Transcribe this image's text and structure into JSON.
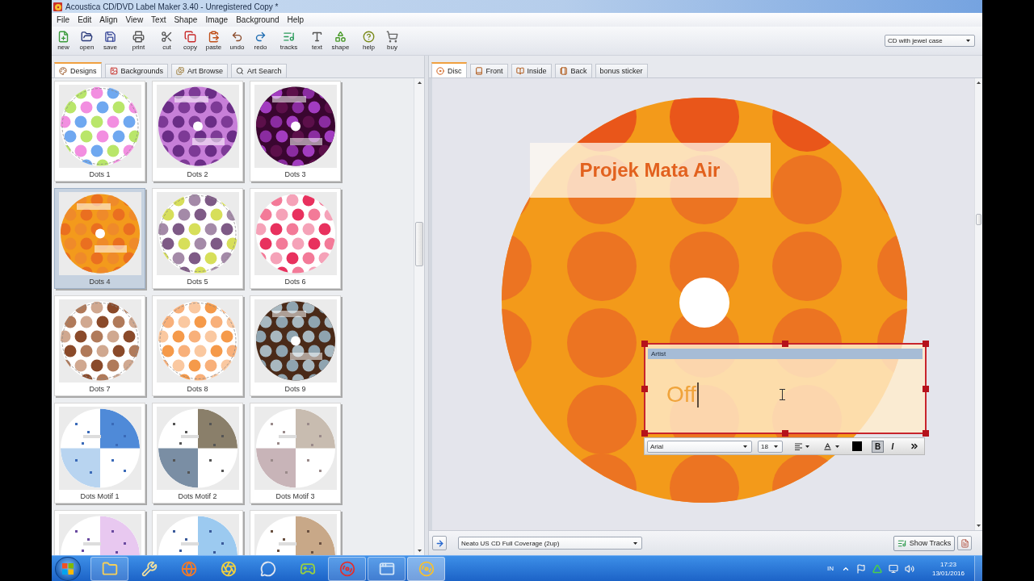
{
  "window": {
    "title": "Acoustica CD/DVD Label Maker 3.40 - Unregistered Copy *"
  },
  "menu": [
    "File",
    "Edit",
    "Align",
    "View",
    "Text",
    "Shape",
    "Image",
    "Background",
    "Help"
  ],
  "toolbar": {
    "groups": [
      [
        "new",
        "open",
        "save"
      ],
      [
        "print"
      ],
      [
        "cut",
        "copy",
        "paste",
        "undo",
        "redo"
      ],
      [
        "tracks"
      ],
      [
        "text",
        "shape"
      ],
      [
        "help",
        "buy"
      ]
    ],
    "layout_select": "CD with jewel case"
  },
  "left_panel": {
    "tabs": [
      {
        "label": "Designs",
        "selected": true
      },
      {
        "label": "Backgrounds",
        "selected": false
      },
      {
        "label": "Art Browse",
        "selected": false
      },
      {
        "label": "Art Search",
        "selected": false
      }
    ],
    "designs": [
      {
        "name": "Dots 1",
        "selected": false
      },
      {
        "name": "Dots 2",
        "selected": false
      },
      {
        "name": "Dots 3",
        "selected": false
      },
      {
        "name": "Dots 4",
        "selected": true
      },
      {
        "name": "Dots 5",
        "selected": false
      },
      {
        "name": "Dots 6",
        "selected": false
      },
      {
        "name": "Dots 7",
        "selected": false
      },
      {
        "name": "Dots 8",
        "selected": false
      },
      {
        "name": "Dots 9",
        "selected": false
      },
      {
        "name": "Dots Motif 1",
        "selected": false
      },
      {
        "name": "Dots Motif 2",
        "selected": false
      },
      {
        "name": "Dots Motif 3",
        "selected": false
      },
      {
        "selected": false
      },
      {
        "selected": false
      },
      {
        "selected": false
      }
    ]
  },
  "right_panel": {
    "tabs": [
      {
        "label": "Disc",
        "selected": true
      },
      {
        "label": "Front",
        "selected": false
      },
      {
        "label": "Inside",
        "selected": false
      },
      {
        "label": "Back",
        "selected": false
      },
      {
        "label": "bonus sticker",
        "selected": false
      }
    ],
    "disc": {
      "text_boxes": [
        {
          "text": "Projek Mata Air",
          "selected": false
        },
        {
          "label": "Artist",
          "text": "Off",
          "selected": true
        }
      ],
      "format_toolbar": {
        "font": "Arial",
        "size": "18",
        "bold": {
          "label": "B",
          "on": true
        },
        "italic": {
          "label": "I",
          "on": false
        }
      }
    },
    "paper_select": "Neato US CD Full Coverage (2up)",
    "show_tracks": "Show Tracks"
  },
  "taskbar": {
    "apps": [
      {
        "running": true,
        "selected": false
      },
      {
        "running": false,
        "selected": false
      },
      {
        "running": false,
        "selected": false
      },
      {
        "running": false,
        "selected": false
      },
      {
        "running": false,
        "selected": false
      },
      {
        "running": false,
        "selected": false
      },
      {
        "running": true,
        "selected": false
      },
      {
        "running": true,
        "selected": false
      },
      {
        "running": true,
        "selected": true
      }
    ],
    "language": "IN",
    "time": "17:23",
    "date": "13/01/2016"
  }
}
